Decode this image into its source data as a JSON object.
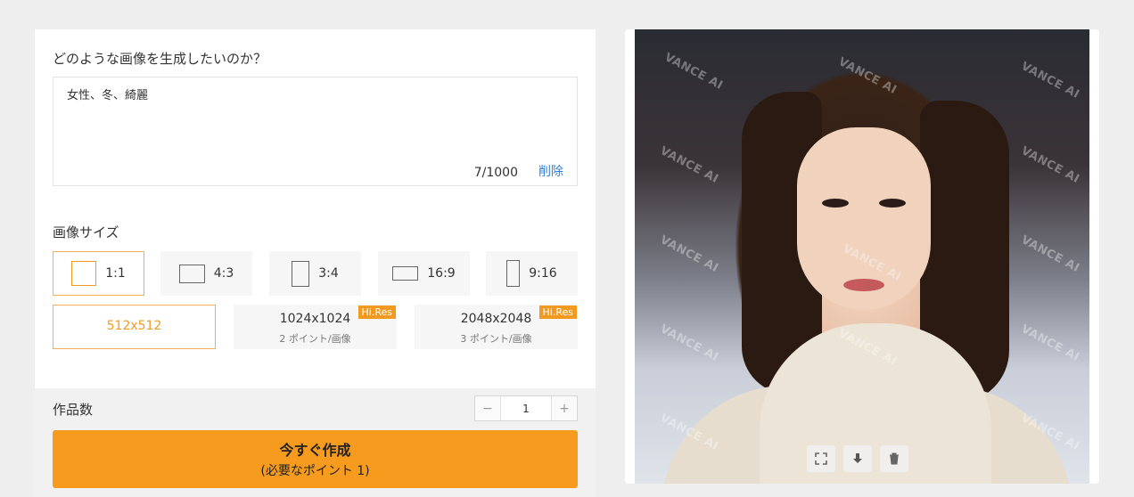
{
  "prompt": {
    "label": "どのような画像を生成したいのか？",
    "value": "女性、冬、綺麗",
    "char_count": "7/1000",
    "delete_label": "削除"
  },
  "image_size": {
    "label": "画像サイズ",
    "ratios": [
      {
        "label": "1:1",
        "selected": true
      },
      {
        "label": "4:3",
        "selected": false
      },
      {
        "label": "3:4",
        "selected": false
      },
      {
        "label": "16:9",
        "selected": false
      },
      {
        "label": "9:16",
        "selected": false
      }
    ],
    "resolutions": [
      {
        "label": "512x512",
        "sub": "",
        "badge": "",
        "selected": true
      },
      {
        "label": "1024x1024",
        "sub": "2 ポイント/画像",
        "badge": "Hi.Res",
        "selected": false
      },
      {
        "label": "2048x2048",
        "sub": "3 ポイント/画像",
        "badge": "Hi.Res",
        "selected": false
      }
    ]
  },
  "count": {
    "label": "作品数",
    "value": "1",
    "minus": "−",
    "plus": "+"
  },
  "create_button": {
    "title": "今すぐ作成",
    "subtitle": "(必要なポイント 1)"
  },
  "preview": {
    "watermark": "VANCE AI",
    "tools": [
      "expand-icon",
      "download-icon",
      "trash-icon"
    ]
  },
  "colors": {
    "accent": "#f79b1f",
    "link": "#2e7fd6",
    "selected_border": "#f0b052"
  }
}
